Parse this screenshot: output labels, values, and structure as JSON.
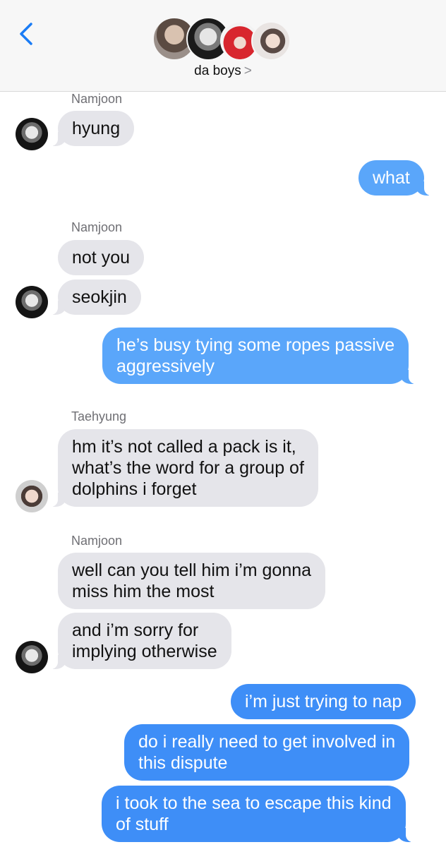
{
  "header": {
    "group_name": "da boys",
    "chevron": ">",
    "back_icon": "chevron-left-icon",
    "avatars": [
      "member-1-avatar",
      "member-2-avatar",
      "member-3-avatar",
      "member-4-avatar"
    ]
  },
  "colors": {
    "outgoing": "#3e8ef7",
    "incoming": "#e5e5ea",
    "accent": "#1a7cf5"
  },
  "messages": [
    {
      "sender": "Namjoon"
    },
    {
      "text": "hyung"
    },
    {
      "text": "what"
    },
    {
      "sender": "Namjoon"
    },
    {
      "text": "not you"
    },
    {
      "text": "seokjin"
    },
    {
      "line1": "he’s busy tying some ropes passive",
      "line2": "aggressively"
    },
    {
      "sender": "Taehyung"
    },
    {
      "line1": "hm it’s not called a pack is it,",
      "line2": "what’s the word for a group of",
      "line3": "dolphins i forget"
    },
    {
      "sender": "Namjoon"
    },
    {
      "line1": "well can you tell him i’m gonna",
      "line2": "miss him the most"
    },
    {
      "line1": "and i’m sorry for",
      "line2": "implying otherwise"
    },
    {
      "text": "i’m just trying to nap"
    },
    {
      "line1": "do i really need to get involved in",
      "line2": "this dispute"
    },
    {
      "line1": "i took to the sea to escape this kind",
      "line2": "of stuff"
    }
  ]
}
